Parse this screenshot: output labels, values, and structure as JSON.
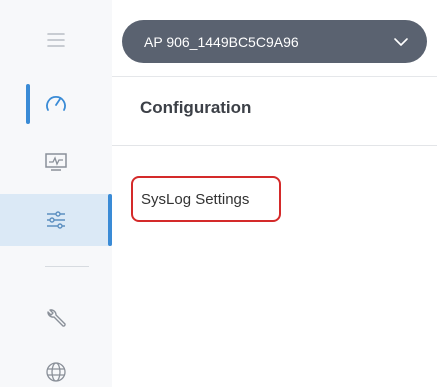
{
  "device_selector": {
    "label": "AP 906_1449BC5C9A96",
    "icon": "chevron-down-icon"
  },
  "sidebar": {
    "items": [
      {
        "name": "menu",
        "icon": "hamburger-icon"
      },
      {
        "name": "dashboard",
        "icon": "speedometer-icon"
      },
      {
        "name": "monitoring",
        "icon": "monitor-chart-icon"
      },
      {
        "name": "configuration",
        "icon": "sliders-icon"
      },
      {
        "name": "maintenance",
        "icon": "wrench-icon"
      },
      {
        "name": "network",
        "icon": "globe-icon"
      }
    ]
  },
  "main": {
    "title": "Configuration",
    "links": [
      {
        "label": "SysLog Settings"
      }
    ]
  },
  "colors": {
    "accent": "#3a8bd6",
    "selector_bg": "#5a6270",
    "highlight_border": "#d42a2a",
    "selected_bg": "#dbe9f6"
  }
}
